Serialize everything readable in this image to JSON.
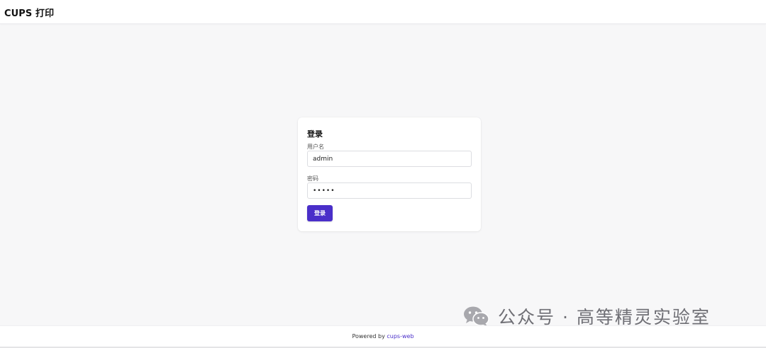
{
  "header": {
    "title": "CUPS 打印"
  },
  "login": {
    "title": "登录",
    "username_label": "用户名",
    "username_value": "admin",
    "password_label": "密码",
    "password_value": "•••••",
    "submit_label": "登录"
  },
  "footer": {
    "prefix": "Powered by ",
    "link_text": "cups-web"
  },
  "watermark": {
    "icon": "wechat-icon",
    "text": "公众号 · 高等精灵实验室"
  },
  "colors": {
    "accent": "#4a2fc9",
    "background": "#f7f7f8",
    "card": "#ffffff"
  }
}
